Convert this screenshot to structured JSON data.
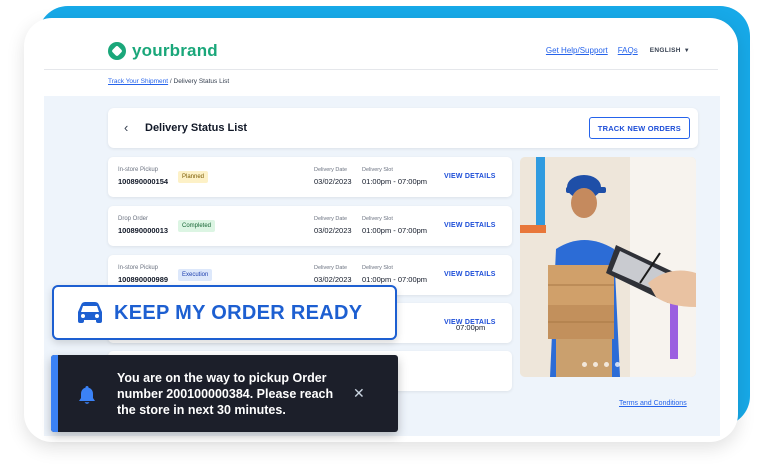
{
  "brand": {
    "name": "yourbrand",
    "color": "#1aa77a"
  },
  "nav": {
    "help_link": "Get Help/Support",
    "faqs_link": "FAQs",
    "language": "ENGLISH"
  },
  "breadcrumb": {
    "link": "Track Your Shipment",
    "separator": "/",
    "current": "Delivery Status List"
  },
  "page": {
    "title": "Delivery Status List",
    "track_button": "TRACK NEW ORDERS"
  },
  "orders": [
    {
      "type": "In-store Pickup",
      "number": "100890000154",
      "status": "Planned",
      "date_label": "Delivery Date",
      "date": "03/02/2023",
      "slot_label": "Delivery Slot",
      "slot": "01:00pm - 07:00pm",
      "action": "VIEW DETAILS"
    },
    {
      "type": "Drop Order",
      "number": "100890000013",
      "status": "Completed",
      "date_label": "Delivery Date",
      "date": "03/02/2023",
      "slot_label": "Delivery Slot",
      "slot": "01:00pm - 07:00pm",
      "action": "VIEW DETAILS"
    },
    {
      "type": "In-store Pickup",
      "number": "100890000989",
      "status": "Execution",
      "date_label": "Delivery Date",
      "date": "03/02/2023",
      "slot_label": "Delivery Slot",
      "slot": "01:00pm - 07:00pm",
      "action": "VIEW DETAILS"
    },
    {
      "slot": "07:00pm",
      "action": "VIEW DETAILS"
    }
  ],
  "status_colors": {
    "Planned": {
      "bg": "#fdf1c7",
      "fg": "#7a5a00"
    },
    "Completed": {
      "bg": "#dcf5e3",
      "fg": "#166534"
    },
    "Execution": {
      "bg": "#dde8fb",
      "fg": "#1e40af"
    }
  },
  "footer": {
    "terms": "Terms and Conditions"
  },
  "ready_banner": {
    "label": "KEEP MY ORDER READY",
    "icon": "car-icon"
  },
  "toast": {
    "message": "You are on the way to pickup Order number 200100000384. Please reach the store in next 30 minutes.",
    "icon": "bell-icon",
    "close_icon": "close-icon"
  },
  "accent_colors": {
    "frame": "#17a9e8",
    "primary": "#1d5fd1",
    "toast_bg": "#1c1f2a"
  }
}
